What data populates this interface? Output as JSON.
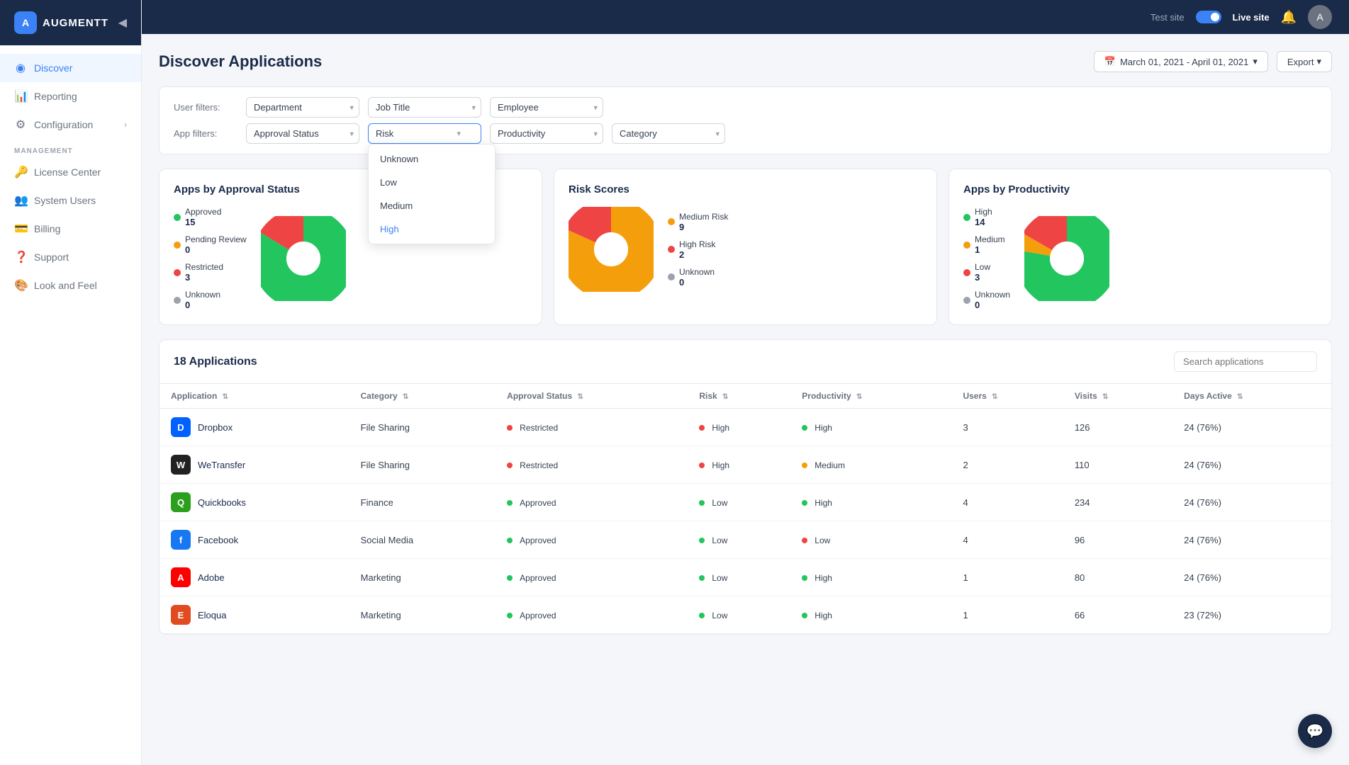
{
  "sidebar": {
    "logo_text": "AUGMENTT",
    "items": [
      {
        "id": "discover",
        "label": "Discover",
        "icon": "◉",
        "active": true
      },
      {
        "id": "reporting",
        "label": "Reporting",
        "icon": "📊",
        "active": false
      },
      {
        "id": "configuration",
        "label": "Configuration",
        "icon": "⚙",
        "active": false,
        "has_chevron": true
      }
    ],
    "management_label": "MANAGEMENT",
    "management_items": [
      {
        "id": "license",
        "label": "License Center",
        "icon": "🔑"
      },
      {
        "id": "system-users",
        "label": "System Users",
        "icon": "👥"
      },
      {
        "id": "billing",
        "label": "Billing",
        "icon": "💳"
      },
      {
        "id": "support",
        "label": "Support",
        "icon": "❓"
      },
      {
        "id": "look-feel",
        "label": "Look and Feel",
        "icon": "🎨"
      }
    ]
  },
  "topbar": {
    "test_label": "Test site",
    "live_label": "Live site",
    "avatar_initial": "A"
  },
  "page": {
    "title": "Discover Applications",
    "date_range": "March 01, 2021 - April 01, 2021",
    "export_label": "Export"
  },
  "filters": {
    "user_filters_label": "User filters:",
    "app_filters_label": "App filters:",
    "department_placeholder": "Department",
    "job_title_placeholder": "Job Title",
    "employee_placeholder": "Employee",
    "approval_status_placeholder": "Approval Status",
    "risk_placeholder": "Risk",
    "productivity_placeholder": "Productivity",
    "category_placeholder": "Category"
  },
  "risk_dropdown": {
    "options": [
      "Unknown",
      "Low",
      "Medium",
      "High"
    ],
    "selected": "High"
  },
  "charts": {
    "approval": {
      "title": "Apps by Approval Status",
      "legend": [
        {
          "label": "Approved",
          "count": "15",
          "color": "#22c55e"
        },
        {
          "label": "Pending Review",
          "count": "0",
          "color": "#f59e0b"
        },
        {
          "label": "Restricted",
          "count": "3",
          "color": "#ef4444"
        },
        {
          "label": "Unknown",
          "count": "0",
          "color": "#d1d5db"
        }
      ]
    },
    "risk": {
      "title": "Risk Scores",
      "legend": [
        {
          "label": "Medium Risk",
          "count": "9",
          "color": "#f59e0b"
        },
        {
          "label": "High Risk",
          "count": "2",
          "color": "#ef4444"
        },
        {
          "label": "Unknown",
          "count": "0",
          "color": "#d1d5db"
        }
      ]
    },
    "productivity": {
      "title": "Apps by Productivity",
      "legend": [
        {
          "label": "High",
          "count": "14",
          "color": "#22c55e"
        },
        {
          "label": "Medium",
          "count": "1",
          "color": "#f59e0b"
        },
        {
          "label": "Low",
          "count": "3",
          "color": "#ef4444"
        },
        {
          "label": "Unknown",
          "count": "0",
          "color": "#d1d5db"
        }
      ]
    }
  },
  "table": {
    "apps_count": "18 Applications",
    "search_placeholder": "Search applications",
    "columns": [
      "Application",
      "Category",
      "Approval Status",
      "Risk",
      "Productivity",
      "Users",
      "Visits",
      "Days Active"
    ],
    "rows": [
      {
        "name": "Dropbox",
        "category": "File Sharing",
        "approval": "Restricted",
        "approval_color": "red",
        "risk": "High",
        "risk_color": "red",
        "productivity": "High",
        "prod_color": "green",
        "users": "3",
        "visits": "126",
        "days": "24 (76%)",
        "icon_bg": "#0061ff",
        "icon_text": "D"
      },
      {
        "name": "WeTransfer",
        "category": "File Sharing",
        "approval": "Restricted",
        "approval_color": "red",
        "risk": "High",
        "risk_color": "red",
        "productivity": "Medium",
        "prod_color": "yellow",
        "users": "2",
        "visits": "110",
        "days": "24 (76%)",
        "icon_bg": "#222",
        "icon_text": "W"
      },
      {
        "name": "Quickbooks",
        "category": "Finance",
        "approval": "Approved",
        "approval_color": "green",
        "risk": "Low",
        "risk_color": "green",
        "productivity": "High",
        "prod_color": "green",
        "users": "4",
        "visits": "234",
        "days": "24 (76%)",
        "icon_bg": "#2ca01c",
        "icon_text": "Q"
      },
      {
        "name": "Facebook",
        "category": "Social Media",
        "approval": "Approved",
        "approval_color": "green",
        "risk": "Low",
        "risk_color": "green",
        "productivity": "Low",
        "prod_color": "red",
        "users": "4",
        "visits": "96",
        "days": "24 (76%)",
        "icon_bg": "#1877f2",
        "icon_text": "f"
      },
      {
        "name": "Adobe",
        "category": "Marketing",
        "approval": "Approved",
        "approval_color": "green",
        "risk": "Low",
        "risk_color": "green",
        "productivity": "High",
        "prod_color": "green",
        "users": "1",
        "visits": "80",
        "days": "24 (76%)",
        "icon_bg": "#ff0000",
        "icon_text": "A"
      },
      {
        "name": "Eloqua",
        "category": "Marketing",
        "approval": "Approved",
        "approval_color": "green",
        "risk": "Low",
        "risk_color": "green",
        "productivity": "High",
        "prod_color": "green",
        "users": "1",
        "visits": "66",
        "days": "23 (72%)",
        "icon_bg": "#e04b21",
        "icon_text": "E"
      }
    ]
  },
  "chat_icon": "💬"
}
